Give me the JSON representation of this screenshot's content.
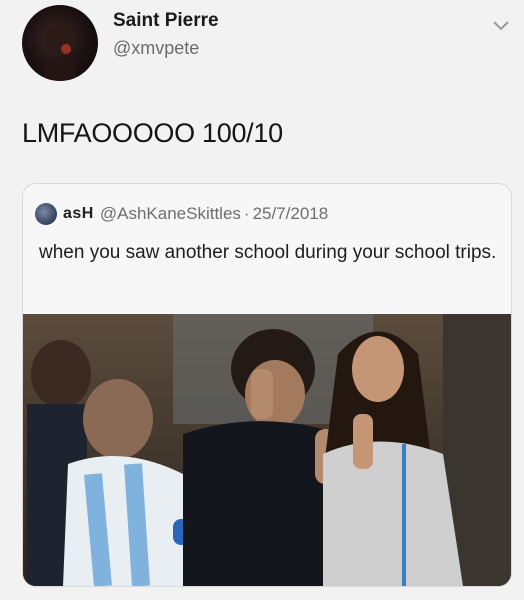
{
  "tweet": {
    "display_name": "Saint Pierre",
    "handle": "@xmvpete",
    "text": "LMFAOOOOO 100/10"
  },
  "quoted_tweet": {
    "display_name": "asH",
    "handle": "@AshKaneSkittles",
    "separator": "·",
    "date": "25/7/2018",
    "text": "when you saw another school during your school trips."
  },
  "icons": {
    "author_avatar": "avatar",
    "quoted_avatar": "avatar",
    "menu": "chevron-down-icon"
  },
  "colors": {
    "background": "#f2f2f2",
    "secondary_text": "#6b6b6b",
    "border": "#d8d8d8"
  }
}
